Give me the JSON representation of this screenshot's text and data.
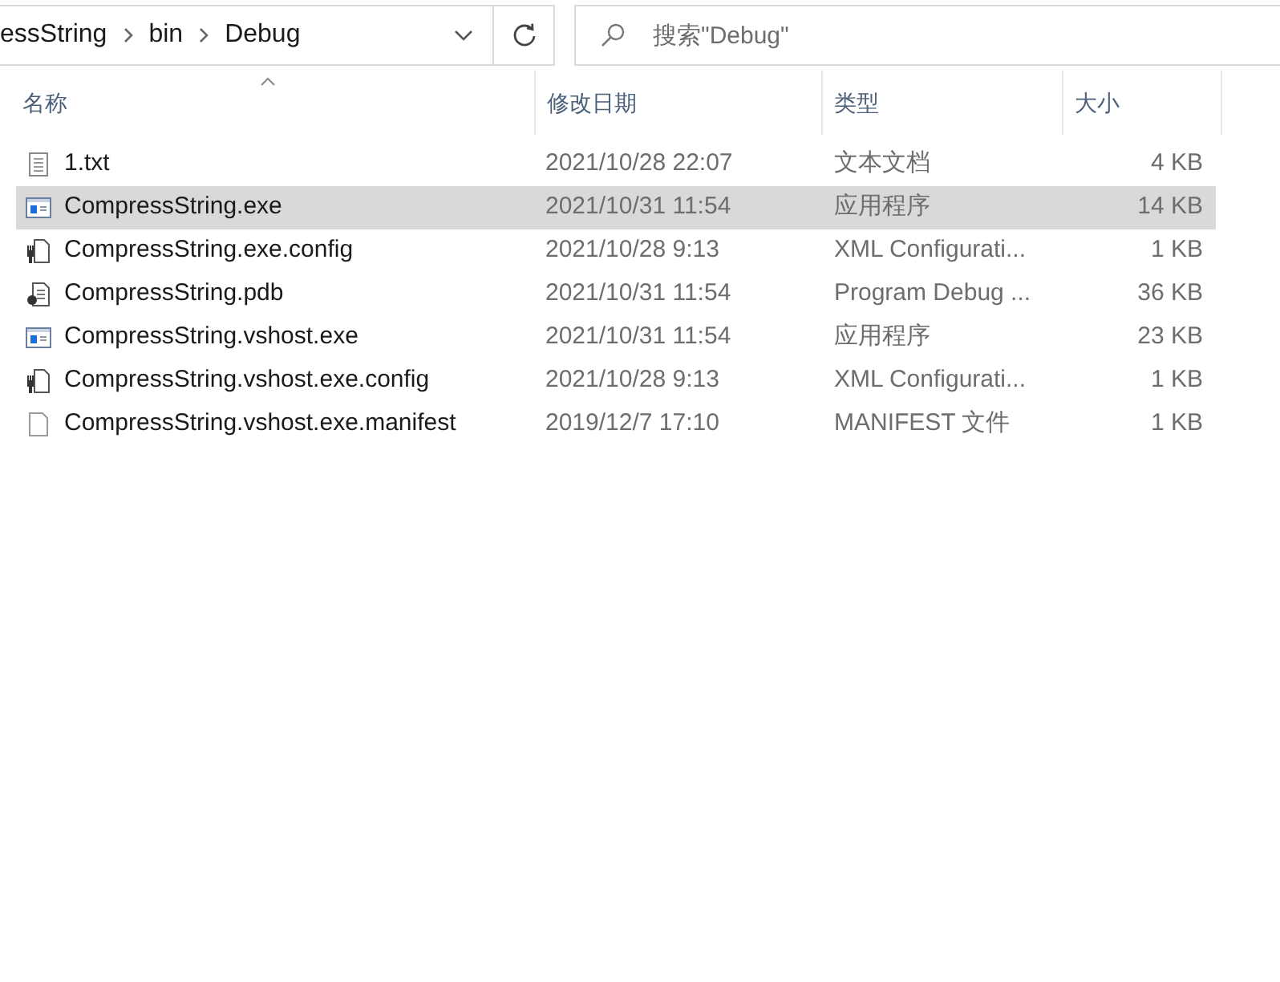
{
  "address_bar": {
    "crumbs": [
      "essString",
      "bin",
      "Debug"
    ]
  },
  "search": {
    "placeholder": "搜索\"Debug\""
  },
  "columns": [
    {
      "label": "名称",
      "sorted": true
    },
    {
      "label": "修改日期",
      "sorted": false
    },
    {
      "label": "类型",
      "sorted": false
    },
    {
      "label": "大小",
      "sorted": false
    }
  ],
  "files": [
    {
      "kind": "text",
      "name": "1.txt",
      "modified": "2021/10/28 22:07",
      "type": "文本文档",
      "size": "4 KB",
      "selected": false
    },
    {
      "kind": "exe",
      "name": "CompressString.exe",
      "modified": "2021/10/31 11:54",
      "type": "应用程序",
      "size": "14 KB",
      "selected": true
    },
    {
      "kind": "config",
      "name": "CompressString.exe.config",
      "modified": "2021/10/28 9:13",
      "type": "XML Configurati...",
      "size": "1 KB",
      "selected": false
    },
    {
      "kind": "pdb",
      "name": "CompressString.pdb",
      "modified": "2021/10/31 11:54",
      "type": "Program Debug ...",
      "size": "36 KB",
      "selected": false
    },
    {
      "kind": "exe",
      "name": "CompressString.vshost.exe",
      "modified": "2021/10/31 11:54",
      "type": "应用程序",
      "size": "23 KB",
      "selected": false
    },
    {
      "kind": "config",
      "name": "CompressString.vshost.exe.config",
      "modified": "2021/10/28 9:13",
      "type": "XML Configurati...",
      "size": "1 KB",
      "selected": false
    },
    {
      "kind": "blank",
      "name": "CompressString.vshost.exe.manifest",
      "modified": "2019/12/7 17:10",
      "type": "MANIFEST 文件",
      "size": "1 KB",
      "selected": false
    }
  ]
}
